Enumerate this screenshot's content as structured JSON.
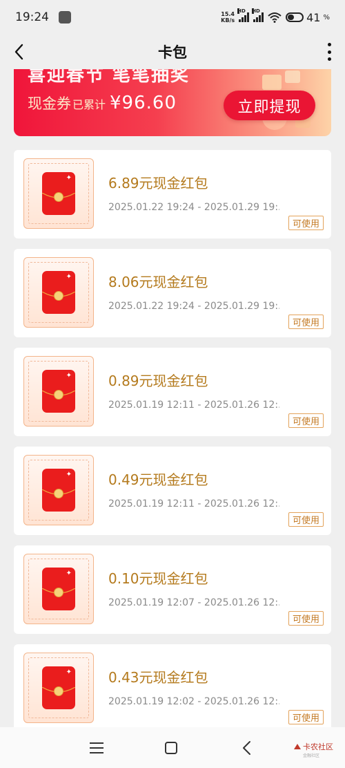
{
  "status_bar": {
    "time": "19:24",
    "net_speed": "15.4",
    "net_unit": "KB/s",
    "signal1_label": "HD",
    "signal2_label": "HD",
    "wifi_sub": "6",
    "battery": "41",
    "battery_unit": "%"
  },
  "header": {
    "title": "卡包"
  },
  "banner": {
    "top_partial_text": "喜迎春节 笔笔抽奖",
    "label": "现金券",
    "sublabel": "已累计",
    "amount": "¥96.60",
    "button_label": "立即提现"
  },
  "coupons": [
    {
      "title": "6.89元现金红包",
      "date": "2025.01.22 19:24 - 2025.01.29 19:...",
      "status": "可使用"
    },
    {
      "title": "8.06元现金红包",
      "date": "2025.01.22 19:24 - 2025.01.29 19:...",
      "status": "可使用"
    },
    {
      "title": "0.89元现金红包",
      "date": "2025.01.19 12:11 - 2025.01.26 12:...",
      "status": "可使用"
    },
    {
      "title": "0.49元现金红包",
      "date": "2025.01.19 12:11 - 2025.01.26 12:...",
      "status": "可使用"
    },
    {
      "title": "0.10元现金红包",
      "date": "2025.01.19 12:07 - 2025.01.26 12:...",
      "status": "可使用"
    },
    {
      "title": "0.43元现金红包",
      "date": "2025.01.19 12:02 - 2025.01.26 12:...",
      "status": "可使用"
    }
  ],
  "watermark": {
    "name": "卡农社区",
    "sub": "金融社区"
  },
  "colors": {
    "accent_red": "#ea1534",
    "gold_text": "#b47a1d",
    "badge_border": "#e3a25a"
  },
  "icons": [
    "back-arrow-icon",
    "more-vertical-icon",
    "red-envelope-icon",
    "menu-icon",
    "home-icon",
    "back-nav-icon",
    "wifi-icon",
    "battery-icon"
  ]
}
